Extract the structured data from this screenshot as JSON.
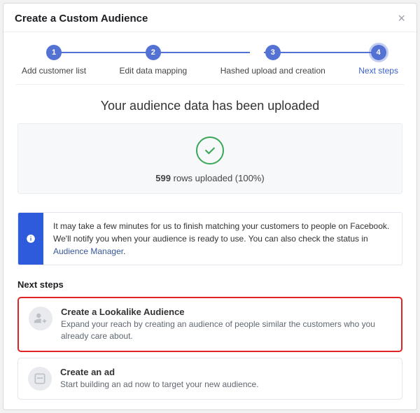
{
  "modal": {
    "title": "Create a Custom Audience"
  },
  "stepper": {
    "steps": [
      {
        "num": "1",
        "label": "Add customer list"
      },
      {
        "num": "2",
        "label": "Edit data mapping"
      },
      {
        "num": "3",
        "label": "Hashed upload and creation"
      },
      {
        "num": "4",
        "label": "Next steps"
      }
    ]
  },
  "upload": {
    "heading": "Your audience data has been uploaded",
    "rows_count": "599",
    "rows_suffix": " rows uploaded (100%)"
  },
  "info": {
    "text_prefix": "It may take a few minutes for us to finish matching your customers to people on Facebook. We'll notify you when your audience is ready to use. You can also check the status in ",
    "link_text": "Audience Manager",
    "text_suffix": "."
  },
  "next_steps": {
    "title": "Next steps",
    "options": [
      {
        "title": "Create a Lookalike Audience",
        "desc": "Expand your reach by creating an audience of people similar the customers who you already care about."
      },
      {
        "title": "Create an ad",
        "desc": "Start building an ad now to target your new audience."
      }
    ]
  }
}
